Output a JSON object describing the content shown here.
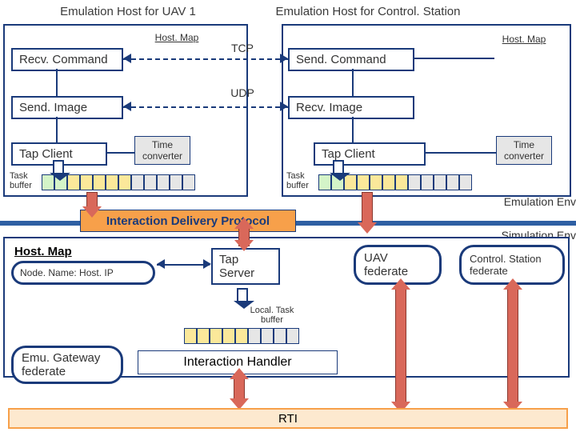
{
  "hosts": {
    "uav1_title": "Emulation Host for UAV 1",
    "cs_title": "Emulation Host for Control. Station"
  },
  "uav1": {
    "recv_command": "Recv. Command",
    "send_image": "Send. Image",
    "tap_client": "Tap Client",
    "hostmap": "Host. Map",
    "time_converter": "Time\nconverter",
    "task_buffer": "Task\nbuffer"
  },
  "cs": {
    "send_command": "Send. Command",
    "recv_image": "Recv. Image",
    "tap_client": "Tap Client",
    "hostmap": "Host. Map",
    "time_converter": "Time\nconverter",
    "task_buffer": "Task\nbuffer"
  },
  "protocols": {
    "tcp": "TCP",
    "udp": "UDP"
  },
  "env": {
    "emulation": "Emulation Env",
    "simulation": "Simulation Env"
  },
  "idp": "Interaction Delivery Protocol",
  "sim": {
    "hostmap_title": "Host. Map",
    "hostmap_sub": "Node. Name: Host. IP",
    "tap_server": "Tap\nServer",
    "uav_federate": "UAV\nfederate",
    "cs_federate": "Control. Station\nfederate",
    "local_task_buffer": "Local. Task\nbuffer",
    "emu_gateway": "Emu. Gateway\nfederate",
    "interaction_handler": "Interaction Handler",
    "rti": "RTI"
  }
}
